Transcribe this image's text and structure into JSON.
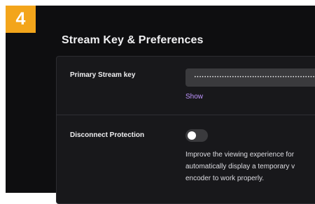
{
  "step_badge": "4",
  "section": {
    "title": "Stream Key & Preferences"
  },
  "stream_key": {
    "label": "Primary Stream key",
    "masked_value": "••••••••••••••••••••••••••••••••••••••••••••••••",
    "show_label": "Show"
  },
  "disconnect_protection": {
    "label": "Disconnect Protection",
    "enabled": false,
    "description_lines": [
      "Improve the viewing experience for",
      "automatically display a temporary v",
      "encoder to work properly."
    ]
  },
  "colors": {
    "accent": "#bf94ff",
    "badge": "#f3a51b",
    "background": "#0e0e10",
    "card": "#18181b"
  }
}
